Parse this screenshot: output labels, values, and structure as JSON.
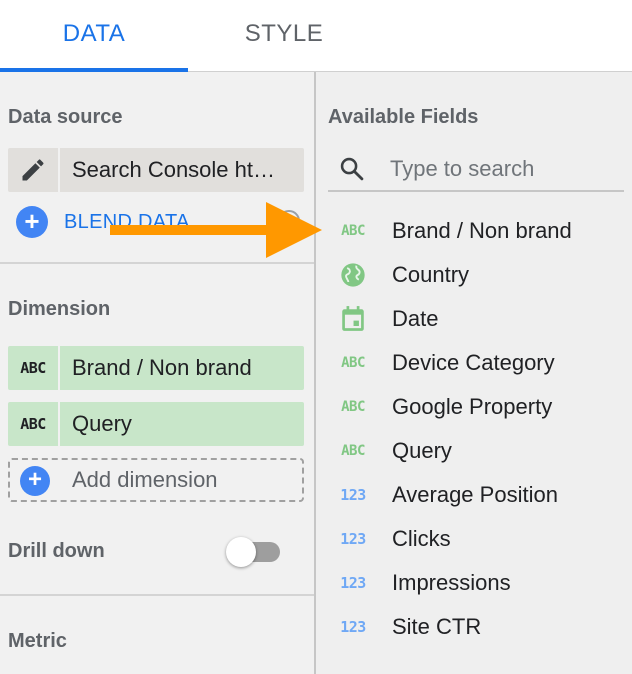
{
  "tabs": [
    {
      "label": "DATA",
      "active": true
    },
    {
      "label": "STYLE",
      "active": false
    }
  ],
  "left_panel": {
    "data_source": {
      "title": "Data source",
      "source_name": "Search Console ht…",
      "edit_icon": "pencil-icon",
      "blend_label": "BLEND DATA",
      "help_icon": "help-circle-icon"
    },
    "dimension": {
      "title": "Dimension",
      "chips": [
        {
          "type": "ABC",
          "label": "Brand / Non brand"
        },
        {
          "type": "ABC",
          "label": "Query"
        }
      ],
      "add_label": "Add dimension"
    },
    "drill_down": {
      "title": "Drill down",
      "enabled": false
    },
    "metric": {
      "title": "Metric"
    }
  },
  "right_panel": {
    "title": "Available Fields",
    "search": {
      "placeholder": "Type to search",
      "value": "",
      "icon": "search-icon"
    },
    "fields": [
      {
        "icon": "text",
        "glyph": "ABC",
        "label": "Brand / Non brand"
      },
      {
        "icon": "globe-icon",
        "glyph": "",
        "label": "Country"
      },
      {
        "icon": "calendar-icon",
        "glyph": "",
        "label": "Date"
      },
      {
        "icon": "text",
        "glyph": "ABC",
        "label": "Device Category"
      },
      {
        "icon": "text",
        "glyph": "ABC",
        "label": "Google Property"
      },
      {
        "icon": "text",
        "glyph": "ABC",
        "label": "Query"
      },
      {
        "icon": "number",
        "glyph": "123",
        "label": "Average Position"
      },
      {
        "icon": "number",
        "glyph": "123",
        "label": "Clicks"
      },
      {
        "icon": "number",
        "glyph": "123",
        "label": "Impressions"
      },
      {
        "icon": "number",
        "glyph": "123",
        "label": "Site CTR"
      }
    ]
  },
  "colors": {
    "accent": "#1a73e8",
    "dimension_chip": "#c8e6c9",
    "text_type_icon": "#81c784",
    "number_type_icon": "#6fa8f5",
    "annotation_arrow": "#ff9800"
  }
}
